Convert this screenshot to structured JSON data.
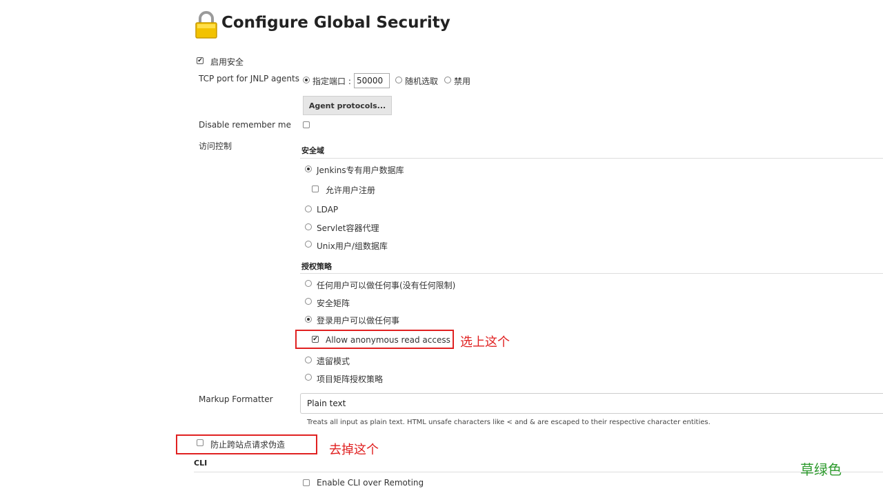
{
  "page": {
    "title": "Configure Global Security"
  },
  "enable_security": {
    "label": "启用安全",
    "checked": true
  },
  "tcp_port": {
    "label": "TCP port for JNLP agents",
    "options": [
      {
        "label": "指定端口 :",
        "selected": true
      },
      {
        "label": "随机选取",
        "selected": false
      },
      {
        "label": "禁用",
        "selected": false
      }
    ],
    "port_value": "50000",
    "agent_protocols_button": "Agent protocols..."
  },
  "disable_remember_me": {
    "label": "Disable remember me",
    "checked": false
  },
  "access_control": {
    "label": "访问控制",
    "security_realm": {
      "title": "安全域",
      "options": [
        {
          "label": "Jenkins专有用户数据库",
          "selected": true
        },
        {
          "label": "LDAP",
          "selected": false
        },
        {
          "label": "Servlet容器代理",
          "selected": false
        },
        {
          "label": "Unix用户/组数据库",
          "selected": false
        }
      ],
      "allow_signup": {
        "label": "允许用户注册",
        "checked": false
      }
    },
    "authorization": {
      "title": "授权策略",
      "options": [
        {
          "label": "任何用户可以做任何事(没有任何限制)",
          "selected": false
        },
        {
          "label": "安全矩阵",
          "selected": false
        },
        {
          "label": "登录用户可以做任何事",
          "selected": true
        },
        {
          "label": "遗留模式",
          "selected": false
        },
        {
          "label": "项目矩阵授权策略",
          "selected": false
        }
      ],
      "allow_anonymous_read": {
        "label": "Allow anonymous read access",
        "checked": true
      }
    }
  },
  "markup_formatter": {
    "label": "Markup Formatter",
    "selected_value": "Plain text",
    "help": "Treats all input as plain text. HTML unsafe characters like < and & are escaped to their respective character entities."
  },
  "csrf": {
    "label": "防止跨站点请求伪造",
    "checked": false
  },
  "cli": {
    "title": "CLI",
    "enable_remoting": {
      "label": "Enable CLI over Remoting",
      "checked": false
    }
  },
  "annotations": {
    "select_this": "选上这个",
    "remove_this": "去掉这个",
    "color": "#e02020"
  },
  "watermark": {
    "text": "草绿色",
    "color": "#2e9b2e"
  }
}
